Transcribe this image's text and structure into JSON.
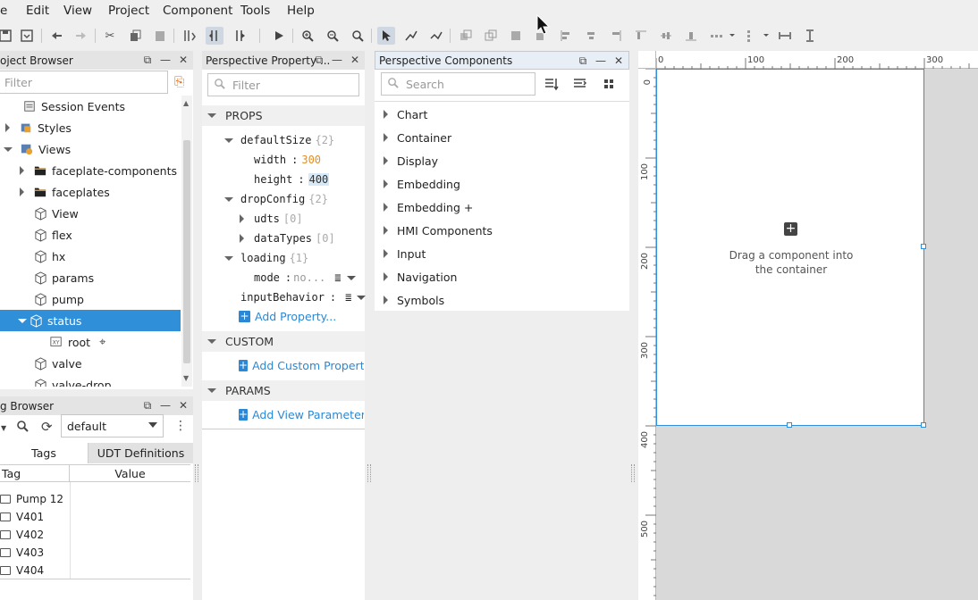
{
  "menu": {
    "file": "e",
    "edit": "Edit",
    "view": "View",
    "project": "Project",
    "component": "Component",
    "tools": "Tools",
    "help": "Help"
  },
  "project_browser": {
    "title": "oject Browser",
    "filter_placeholder": "Filter",
    "items": [
      {
        "label": "Session Events"
      },
      {
        "label": "Styles"
      },
      {
        "label": "Views"
      },
      {
        "label": "faceplate-components"
      },
      {
        "label": "faceplates"
      },
      {
        "label": "View"
      },
      {
        "label": "flex"
      },
      {
        "label": "hx"
      },
      {
        "label": "params"
      },
      {
        "label": "pump"
      },
      {
        "label": "status"
      },
      {
        "label": "root"
      },
      {
        "label": "valve"
      },
      {
        "label": "valve-drop"
      }
    ]
  },
  "tag_browser": {
    "title": "g Browser",
    "provider": "default",
    "tabs": [
      "Tags",
      "UDT Definitions"
    ],
    "columns": [
      "Tag",
      "Value"
    ],
    "rows": [
      "Pump 12",
      "V401",
      "V402",
      "V403",
      "V404"
    ]
  },
  "property_editor": {
    "title": "Perspective Property ...",
    "filter_placeholder": "Filter",
    "sections": {
      "props": "PROPS",
      "custom": "CUSTOM",
      "params": "PARAMS"
    },
    "props": {
      "defaultSize": "defaultSize",
      "defaultSize_count": "{2}",
      "width": "width",
      "width_value": "300",
      "height": "height",
      "height_value": "400",
      "dropConfig": "dropConfig",
      "dropConfig_count": "{2}",
      "udts": "udts",
      "udts_count": "[0]",
      "dataTypes": "dataTypes",
      "dataTypes_count": "[0]",
      "loading": "loading",
      "loading_count": "{1}",
      "mode": "mode",
      "mode_value": "no...",
      "inputBehavior": "inputBehavior",
      "colon": ":"
    },
    "add_property": "Add Property...",
    "add_custom": "Add Custom Property...",
    "add_param": "Add View Parameter..."
  },
  "components_panel": {
    "title": "Perspective Components",
    "search_placeholder": "Search",
    "categories": [
      "Chart",
      "Container",
      "Display",
      "Embedding",
      "Embedding +",
      "HMI Components",
      "Input",
      "Navigation",
      "Symbols"
    ]
  },
  "canvas": {
    "ruler_h": [
      "0",
      "100",
      "200",
      "300"
    ],
    "ruler_v": [
      "0",
      "100",
      "200",
      "300",
      "400",
      "500"
    ],
    "drop_hint_line1": "Drag a component into",
    "drop_hint_line2": "the container",
    "selection_color": "#2f8fd8"
  }
}
